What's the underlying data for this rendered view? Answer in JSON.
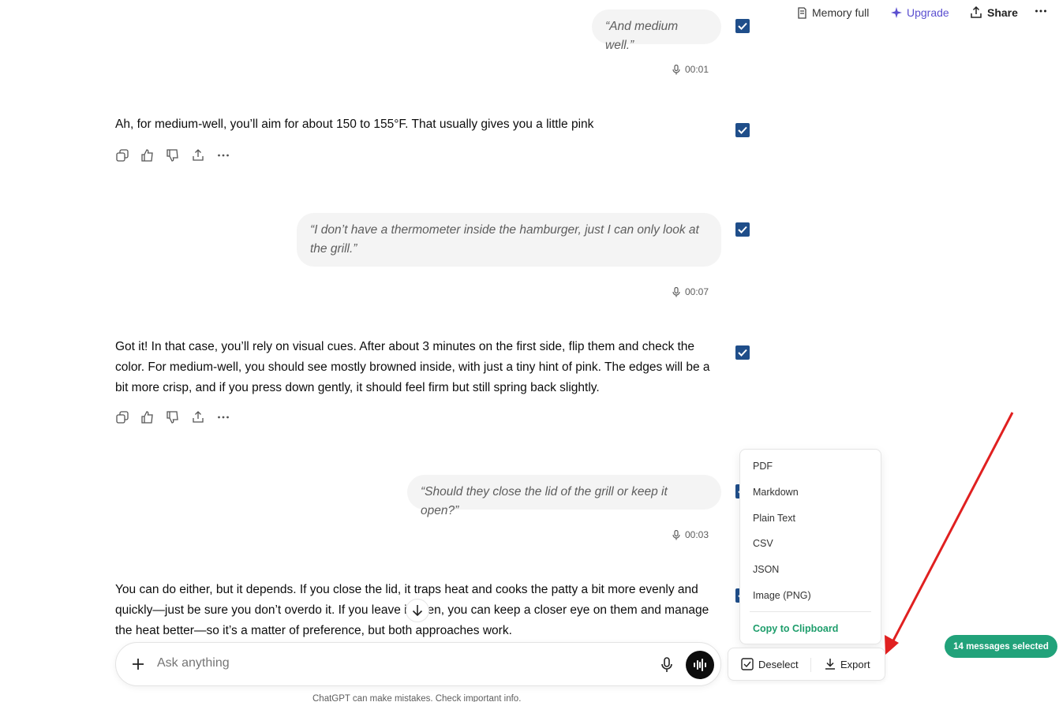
{
  "header": {
    "memory_label": "Memory full",
    "upgrade_label": "Upgrade",
    "share_label": "Share",
    "more_icon": "more-horizontal-icon"
  },
  "messages": [
    {
      "role": "user",
      "text": "“And medium well.”",
      "duration": "00:01"
    },
    {
      "role": "assistant",
      "text": "Ah, for medium-well, you’ll aim for about 150 to 155°F. That usually gives you a little pink"
    },
    {
      "role": "user",
      "text": "“I don’t have a thermometer inside the hamburger, just I can only look at the grill.”",
      "duration": "00:07"
    },
    {
      "role": "assistant",
      "text": "Got it! In that case, you’ll rely on visual cues. After about 3 minutes on the first side, flip them and check the color. For medium-well, you should see mostly browned inside, with just a tiny hint of pink. The edges will be a bit more crisp, and if you press down gently, it should feel firm but still spring back slightly."
    },
    {
      "role": "user",
      "text": "“Should they close the lid of the grill or keep it open?”",
      "duration": "00:03"
    },
    {
      "role": "assistant",
      "text": "You can do either, but it depends. If you close the lid, it traps heat and cooks the patty a bit more evenly and quickly—just be sure you don’t overdo it. If you leave it open, you can keep a closer eye on them and manage the heat better—so it’s a matter of preference, but both approaches work."
    }
  ],
  "composer": {
    "placeholder": "Ask anything",
    "disclaimer": "ChatGPT can make mistakes. Check important info."
  },
  "export_menu": {
    "items": [
      "PDF",
      "Markdown",
      "Plain Text",
      "CSV",
      "JSON",
      "Image (PNG)"
    ],
    "clipboard_label": "Copy to Clipboard"
  },
  "selection_bar": {
    "deselect_label": "Deselect",
    "export_label": "Export"
  },
  "badge": {
    "label": "14 messages selected"
  },
  "colors": {
    "checkbox": "#1f4e8a",
    "badge": "#21a27a",
    "upgrade": "#5b4fd0",
    "arrow": "#e02020",
    "clipboard": "#1d9d6b"
  }
}
